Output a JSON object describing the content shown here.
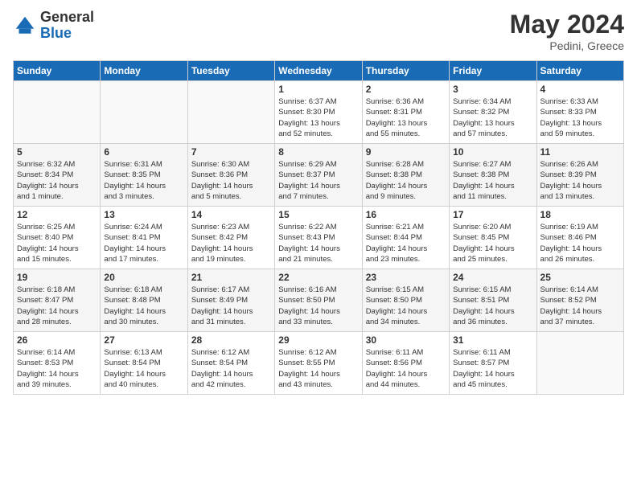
{
  "header": {
    "logo_general": "General",
    "logo_blue": "Blue",
    "title": "May 2024",
    "subtitle": "Pedini, Greece"
  },
  "weekdays": [
    "Sunday",
    "Monday",
    "Tuesday",
    "Wednesday",
    "Thursday",
    "Friday",
    "Saturday"
  ],
  "weeks": [
    [
      {
        "day": "",
        "info": ""
      },
      {
        "day": "",
        "info": ""
      },
      {
        "day": "",
        "info": ""
      },
      {
        "day": "1",
        "info": "Sunrise: 6:37 AM\nSunset: 8:30 PM\nDaylight: 13 hours\nand 52 minutes."
      },
      {
        "day": "2",
        "info": "Sunrise: 6:36 AM\nSunset: 8:31 PM\nDaylight: 13 hours\nand 55 minutes."
      },
      {
        "day": "3",
        "info": "Sunrise: 6:34 AM\nSunset: 8:32 PM\nDaylight: 13 hours\nand 57 minutes."
      },
      {
        "day": "4",
        "info": "Sunrise: 6:33 AM\nSunset: 8:33 PM\nDaylight: 13 hours\nand 59 minutes."
      }
    ],
    [
      {
        "day": "5",
        "info": "Sunrise: 6:32 AM\nSunset: 8:34 PM\nDaylight: 14 hours\nand 1 minute."
      },
      {
        "day": "6",
        "info": "Sunrise: 6:31 AM\nSunset: 8:35 PM\nDaylight: 14 hours\nand 3 minutes."
      },
      {
        "day": "7",
        "info": "Sunrise: 6:30 AM\nSunset: 8:36 PM\nDaylight: 14 hours\nand 5 minutes."
      },
      {
        "day": "8",
        "info": "Sunrise: 6:29 AM\nSunset: 8:37 PM\nDaylight: 14 hours\nand 7 minutes."
      },
      {
        "day": "9",
        "info": "Sunrise: 6:28 AM\nSunset: 8:38 PM\nDaylight: 14 hours\nand 9 minutes."
      },
      {
        "day": "10",
        "info": "Sunrise: 6:27 AM\nSunset: 8:38 PM\nDaylight: 14 hours\nand 11 minutes."
      },
      {
        "day": "11",
        "info": "Sunrise: 6:26 AM\nSunset: 8:39 PM\nDaylight: 14 hours\nand 13 minutes."
      }
    ],
    [
      {
        "day": "12",
        "info": "Sunrise: 6:25 AM\nSunset: 8:40 PM\nDaylight: 14 hours\nand 15 minutes."
      },
      {
        "day": "13",
        "info": "Sunrise: 6:24 AM\nSunset: 8:41 PM\nDaylight: 14 hours\nand 17 minutes."
      },
      {
        "day": "14",
        "info": "Sunrise: 6:23 AM\nSunset: 8:42 PM\nDaylight: 14 hours\nand 19 minutes."
      },
      {
        "day": "15",
        "info": "Sunrise: 6:22 AM\nSunset: 8:43 PM\nDaylight: 14 hours\nand 21 minutes."
      },
      {
        "day": "16",
        "info": "Sunrise: 6:21 AM\nSunset: 8:44 PM\nDaylight: 14 hours\nand 23 minutes."
      },
      {
        "day": "17",
        "info": "Sunrise: 6:20 AM\nSunset: 8:45 PM\nDaylight: 14 hours\nand 25 minutes."
      },
      {
        "day": "18",
        "info": "Sunrise: 6:19 AM\nSunset: 8:46 PM\nDaylight: 14 hours\nand 26 minutes."
      }
    ],
    [
      {
        "day": "19",
        "info": "Sunrise: 6:18 AM\nSunset: 8:47 PM\nDaylight: 14 hours\nand 28 minutes."
      },
      {
        "day": "20",
        "info": "Sunrise: 6:18 AM\nSunset: 8:48 PM\nDaylight: 14 hours\nand 30 minutes."
      },
      {
        "day": "21",
        "info": "Sunrise: 6:17 AM\nSunset: 8:49 PM\nDaylight: 14 hours\nand 31 minutes."
      },
      {
        "day": "22",
        "info": "Sunrise: 6:16 AM\nSunset: 8:50 PM\nDaylight: 14 hours\nand 33 minutes."
      },
      {
        "day": "23",
        "info": "Sunrise: 6:15 AM\nSunset: 8:50 PM\nDaylight: 14 hours\nand 34 minutes."
      },
      {
        "day": "24",
        "info": "Sunrise: 6:15 AM\nSunset: 8:51 PM\nDaylight: 14 hours\nand 36 minutes."
      },
      {
        "day": "25",
        "info": "Sunrise: 6:14 AM\nSunset: 8:52 PM\nDaylight: 14 hours\nand 37 minutes."
      }
    ],
    [
      {
        "day": "26",
        "info": "Sunrise: 6:14 AM\nSunset: 8:53 PM\nDaylight: 14 hours\nand 39 minutes."
      },
      {
        "day": "27",
        "info": "Sunrise: 6:13 AM\nSunset: 8:54 PM\nDaylight: 14 hours\nand 40 minutes."
      },
      {
        "day": "28",
        "info": "Sunrise: 6:12 AM\nSunset: 8:54 PM\nDaylight: 14 hours\nand 42 minutes."
      },
      {
        "day": "29",
        "info": "Sunrise: 6:12 AM\nSunset: 8:55 PM\nDaylight: 14 hours\nand 43 minutes."
      },
      {
        "day": "30",
        "info": "Sunrise: 6:11 AM\nSunset: 8:56 PM\nDaylight: 14 hours\nand 44 minutes."
      },
      {
        "day": "31",
        "info": "Sunrise: 6:11 AM\nSunset: 8:57 PM\nDaylight: 14 hours\nand 45 minutes."
      },
      {
        "day": "",
        "info": ""
      }
    ]
  ]
}
